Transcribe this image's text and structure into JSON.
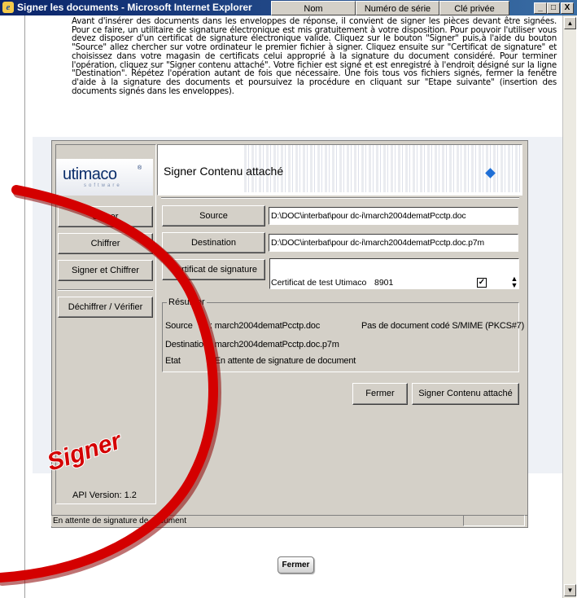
{
  "window": {
    "title": "Signer les documents - Microsoft Internet Explorer",
    "minimize": "_",
    "maximize": "□",
    "close": "X"
  },
  "intro_text": "Avant d'insérer des documents dans les enveloppes de réponse, il convient de signer les pièces devant être signées. Pour ce faire, un utilitaire de signature électronique est mis gratuitement à votre disposition. Pour pouvoir l'utiliser vous devez disposer d'un certificat de signature électronique valide. Cliquez sur le bouton \"Signer\" puis,à l'aide du bouton \"Source\" allez chercher sur votre ordinateur le premier fichier à signer. Cliquez ensuite sur \"Certificat de signature\" et choisissez dans votre magasin de certificats celui approprié à la signature du document considéré. Pour terminer l'opération, cliquez sur \"Signer contenu attaché\". Votre fichier est signé et est enregistré à l'endroit désigné sur la ligne \"Destination\". Répétez l'opération autant de fois que nécessaire. Une fois tous vos fichiers signés, fermer la fenêtre d'aide à la signature des documents et poursuivez la procédure en cliquant sur \"Etape suivante\" (insertion des documents signés dans les enveloppes).",
  "logo": {
    "name": "utimaco",
    "sub": "software"
  },
  "sidebar": {
    "items": [
      {
        "label": "Signer"
      },
      {
        "label": "Chiffrer"
      },
      {
        "label": "Signer et Chiffrer"
      },
      {
        "label": "Déchiffrer / Vérifier"
      }
    ],
    "api_version": "API Version: 1.2"
  },
  "header": {
    "title": "Signer Contenu attaché"
  },
  "source": {
    "button": "Source",
    "value": "D:\\DOC\\interbat\\pour dc-i\\march2004dematPcctp.doc"
  },
  "destination": {
    "button": "Destination",
    "value": "D:\\DOC\\interbat\\pour dc-i\\march2004dematPcctp.doc.p7m"
  },
  "certificate": {
    "button": "Certificat de signature",
    "columns": [
      "Nom",
      "Numéro de série",
      "Clé privée"
    ],
    "row": {
      "name": "Certificat de test Utimaco",
      "serial": "8901",
      "private_key": "✓"
    }
  },
  "summary": {
    "legend": "Résumer",
    "source_label": "Source",
    "source_value": ": march2004dematPcctp.doc",
    "source_note": "Pas de document codé S/MIME (PKCS#7)",
    "destination_label": "Destination",
    "destination_value": ": march2004dematPcctp.doc.p7m",
    "state_label": "Etat",
    "state_value": ": En attente de signature de document"
  },
  "actions": {
    "close": "Fermer",
    "sign": "Signer Contenu attaché"
  },
  "status_bar": "En attente de signature de document",
  "page_close_button": "Fermer",
  "annotation": {
    "text": "Signer",
    "color": "#d40000"
  }
}
